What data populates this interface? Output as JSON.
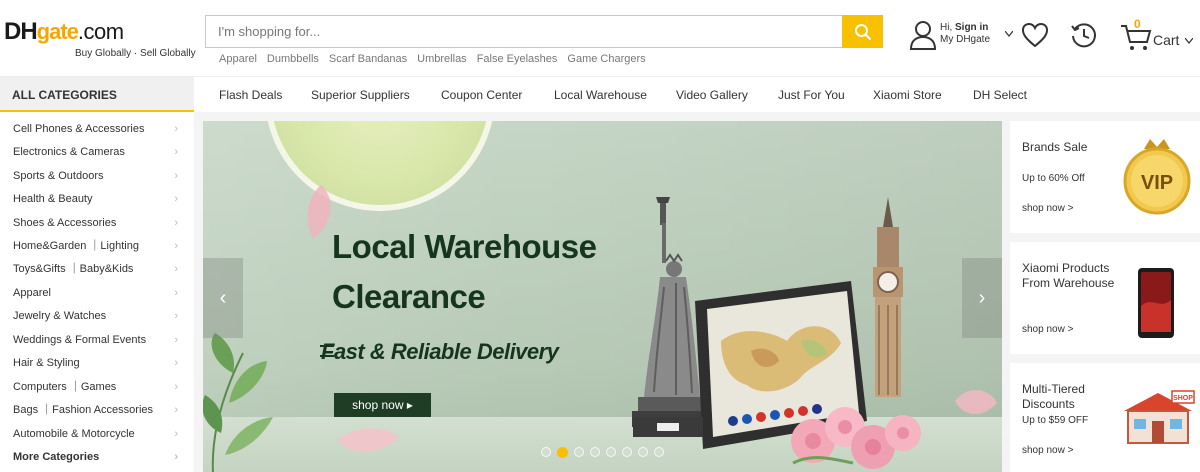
{
  "logo": {
    "dh": "DH",
    "gate": "gate",
    "dotcom": ".com",
    "tagline": "Buy Globally · Sell Globally"
  },
  "search": {
    "placeholder": "I'm shopping for...",
    "value": ""
  },
  "hotwords": [
    "Apparel",
    "Dumbbells",
    "Scarf Bandanas",
    "Umbrellas",
    "False Eyelashes",
    "Game Chargers"
  ],
  "account": {
    "greeting": "Hi, ",
    "signin": "Sign in",
    "mydh": "My DHgate"
  },
  "cart": {
    "count": "0",
    "label": "Cart"
  },
  "nav": {
    "all_categories": "ALL CATEGORIES",
    "links": [
      "Flash Deals",
      "Superior Suppliers",
      "Coupon Center",
      "Local Warehouse",
      "Video Gallery",
      "Just For You",
      "Xiaomi Store",
      "DH Select"
    ]
  },
  "categories": [
    "Cell Phones & Accessories",
    "Electronics & Cameras",
    "Sports & Outdoors",
    "Health & Beauty",
    "Shoes & Accessories",
    "Home&Garden ｜Lighting",
    "Toys&Gifts ｜Baby&Kids",
    "Apparel",
    "Jewelry & Watches",
    "Weddings & Formal Events",
    "Hair & Styling",
    "Computers ｜Games",
    "Bags ｜Fashion Accessories",
    "Automobile & Motorcycle",
    "More Categories"
  ],
  "banner": {
    "title_line1": "Local Warehouse",
    "title_line2": "Clearance",
    "subtitle": "Fast & Reliable Delivery",
    "button": "shop now ▸",
    "active_slide": 2,
    "slide_count": 8
  },
  "promos": [
    {
      "title": "Brands Sale",
      "subtitle": "Up to 60% Off",
      "link": "shop now >",
      "badge": "VIP"
    },
    {
      "title": "Xiaomi Products From Warehouse",
      "subtitle": "",
      "link": "shop now >"
    },
    {
      "title": "Multi-Tiered Discounts",
      "subtitle": "Up to $59 OFF",
      "link": "shop now >",
      "badge": "SHOP"
    }
  ],
  "colors": {
    "accent": "#f7c100",
    "logo_orange": "#f7a600",
    "banner_text": "#15351f",
    "button_dark": "#1e3d24"
  }
}
